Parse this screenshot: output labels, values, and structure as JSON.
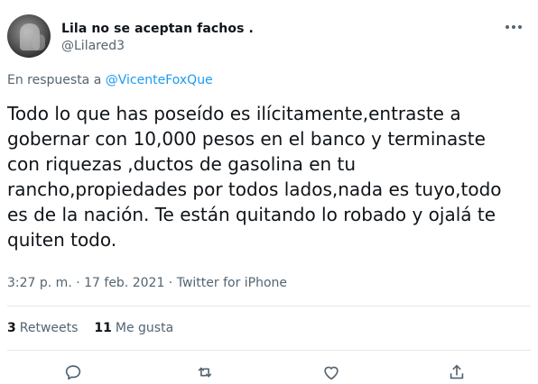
{
  "user": {
    "name": "Lila no se aceptan fachos .",
    "handle": "@Lilared3"
  },
  "reply": {
    "prefix": "En respuesta a ",
    "mention": "@VicenteFoxQue"
  },
  "tweet": {
    "text": "Todo lo que has poseído es ilícitamente,entraste a gobernar con 10,000 pesos en el banco y terminaste con riquezas ,ductos de gasolina en tu rancho,propiedades por todos lados,nada es tuyo,todo es de la nación. Te están quitando lo robado y ojalá te quiten todo.",
    "lines": [
      "Todo lo que has poseído es ilícitamente,entraste a",
      "gobernar con 10,000 pesos en el banco y terminaste",
      "con riquezas ,ductos de gasolina en tu",
      "rancho,propiedades por todos lados,nada es tuyo,todo",
      "es de la nación. Te están quitando lo robado y ojalá te",
      "quiten todo."
    ]
  },
  "meta": {
    "time": "3:27 p. m.",
    "separator": " · ",
    "date": "17 feb. 2021",
    "source": "Twitter for iPhone"
  },
  "stats": {
    "retweets_count": "3",
    "retweets_label": "Retweets",
    "likes_count": "11",
    "likes_label": "Me gusta"
  },
  "icons": {
    "more": "more-options-icon",
    "reply": "reply-icon",
    "retweet": "retweet-icon",
    "like": "heart-icon",
    "share": "share-icon"
  },
  "colors": {
    "text": "#0f1419",
    "secondary": "#536471",
    "link": "#1d9bf0",
    "divider": "#e3e7ea"
  }
}
